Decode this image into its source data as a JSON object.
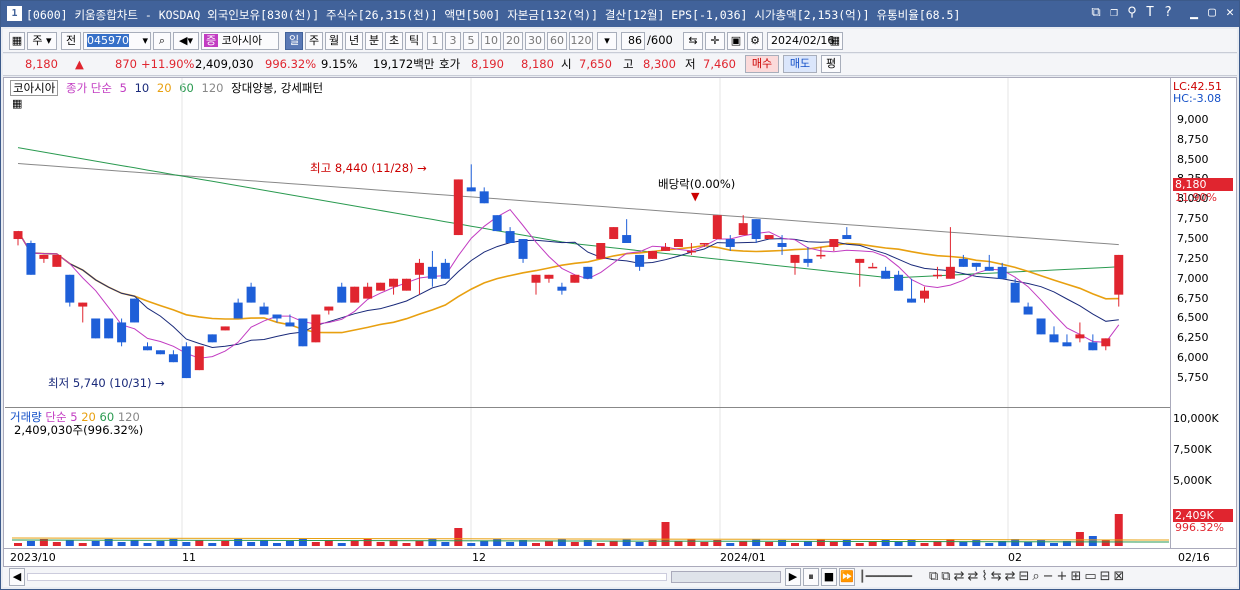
{
  "titlebar": {
    "window_no": "1",
    "title": "[0600] 키움종합차트 - KOSDAQ 외국인보유[830(천)] 주식수[26,315(천)] 액면[500] 자본금[132(억)] 결산[12월] EPS[-1,036] 시가총액[2,153(억)] 유통비율[68.5]"
  },
  "toolbar": {
    "period_week": "주",
    "prev_label": "전",
    "code": "045970",
    "stock_name": "코아시아",
    "tab_day": "일",
    "tab_week": "주",
    "tab_month": "월",
    "tab_year": "년",
    "tab_min": "분",
    "tab_sec": "초",
    "tab_tick": "틱",
    "intervals": [
      "1",
      "3",
      "5",
      "10",
      "20",
      "30",
      "60",
      "120"
    ],
    "count": "86",
    "count_max": "/600",
    "date": "2024/02/16"
  },
  "quote": {
    "price": "8,180",
    "change": "870",
    "change_pct": "+11.90%",
    "volume": "2,409,030",
    "volume_pct": "996.32%",
    "turnover": "9.15%",
    "amount": "19,172백만",
    "hoga_label": "호가",
    "bid": "8,190",
    "ask": "8,180",
    "open_label": "시",
    "open": "7,650",
    "high_label": "고",
    "high": "8,300",
    "low_label": "저",
    "low": "7,460",
    "buy_label": "매수",
    "sell_label": "매도",
    "flat_label": "평"
  },
  "legend": {
    "stock": "코아시아",
    "ma_label": "종가 단순",
    "ma_periods": [
      "5",
      "10",
      "20",
      "60",
      "120"
    ],
    "pattern": "장대양봉, 강세패턴"
  },
  "vol_legend": {
    "label": "거래량",
    "ma_label": "단순",
    "ma_periods": [
      "5",
      "20",
      "60",
      "120"
    ],
    "current": "2,409,030주(996.32%)"
  },
  "annotations": {
    "high": "최고 8,440 (11/28)",
    "low": "최저 5,740 (10/31)",
    "div": "배당락(0.00%)"
  },
  "right_axis": {
    "lc": "LC:42.51",
    "hc": "HC:-3.08",
    "price_ticks": [
      "9,000",
      "8,750",
      "8,500",
      "8,250",
      "8,000",
      "7,750",
      "7,500",
      "7,250",
      "7,000",
      "6,750",
      "6,500",
      "6,250",
      "6,000",
      "5,750"
    ],
    "price_tag": "8,180",
    "price_pct": "11.90%",
    "vol_ticks": [
      "10,000K",
      "7,500K",
      "5,000K"
    ],
    "vol_tag": "2,409K",
    "vol_pct": "996.32%"
  },
  "x_labels": [
    "2023/10",
    "11",
    "12",
    "2024/01",
    "02",
    "02/16"
  ],
  "colors": {
    "up": "#e0252f",
    "down": "#1e5fd8",
    "ma5": "#c23cc2",
    "ma10": "#1a2a7a",
    "ma20": "#e8a010",
    "ma60": "#2a9a50",
    "ma120": "#888888"
  },
  "chart_data": {
    "type": "candlestick",
    "ylim": [
      5600,
      9300
    ],
    "candles": [
      [
        7500,
        7550,
        7420,
        7600
      ],
      [
        7450,
        7480,
        7050,
        7050
      ],
      [
        7250,
        7300,
        7200,
        7300
      ],
      [
        7150,
        7200,
        7150,
        7300
      ],
      [
        7050,
        7050,
        6650,
        6700
      ],
      [
        6650,
        6700,
        6450,
        6700
      ],
      [
        6500,
        6500,
        6250,
        6250
      ],
      [
        6500,
        6500,
        6250,
        6250
      ],
      [
        6450,
        6500,
        6150,
        6200
      ],
      [
        6750,
        6750,
        6450,
        6450
      ],
      [
        6150,
        6200,
        6100,
        6100
      ],
      [
        6100,
        6100,
        6050,
        6050
      ],
      [
        6050,
        6100,
        5950,
        5950
      ],
      [
        6150,
        6200,
        5750,
        5750
      ],
      [
        5850,
        6150,
        5850,
        6150
      ],
      [
        6300,
        6300,
        6200,
        6200
      ],
      [
        6350,
        6400,
        6350,
        6400
      ],
      [
        6700,
        6750,
        6500,
        6500
      ],
      [
        6900,
        6950,
        6700,
        6700
      ],
      [
        6650,
        6700,
        6550,
        6550
      ],
      [
        6550,
        6550,
        6450,
        6500
      ],
      [
        6450,
        6550,
        6400,
        6400
      ],
      [
        6500,
        6500,
        6150,
        6150
      ],
      [
        6200,
        6550,
        6200,
        6550
      ],
      [
        6600,
        6650,
        6550,
        6650
      ],
      [
        6900,
        6950,
        6700,
        6700
      ],
      [
        6700,
        6900,
        6700,
        6900
      ],
      [
        6750,
        6950,
        6750,
        6900
      ],
      [
        6850,
        6900,
        6850,
        6950
      ],
      [
        6900,
        7000,
        6800,
        7000
      ],
      [
        6850,
        7000,
        6850,
        7000
      ],
      [
        7050,
        7250,
        6800,
        7200
      ],
      [
        7150,
        7350,
        6900,
        7000
      ],
      [
        7200,
        7250,
        7000,
        7000
      ],
      [
        7550,
        8250,
        7550,
        8250
      ],
      [
        8150,
        8440,
        8100,
        8100
      ],
      [
        8100,
        8150,
        7950,
        7950
      ],
      [
        7800,
        7800,
        7600,
        7600
      ],
      [
        7600,
        7650,
        7450,
        7450
      ],
      [
        7500,
        7500,
        7200,
        7250
      ],
      [
        6950,
        7000,
        6800,
        7050
      ],
      [
        7000,
        7050,
        6950,
        7050
      ],
      [
        6900,
        6950,
        6800,
        6850
      ],
      [
        6950,
        7050,
        6950,
        7050
      ],
      [
        7150,
        7150,
        7050,
        7000
      ],
      [
        7250,
        7250,
        7450,
        7450
      ],
      [
        7500,
        7500,
        7650,
        7650
      ],
      [
        7550,
        7750,
        7650,
        7450
      ],
      [
        7300,
        7300,
        7100,
        7150
      ],
      [
        7250,
        7300,
        7350,
        7350
      ],
      [
        7350,
        7450,
        7350,
        7400
      ],
      [
        7400,
        7500,
        7400,
        7500
      ],
      [
        7350,
        7450,
        7300,
        7350
      ],
      [
        7450,
        7450,
        7400,
        7450
      ],
      [
        7500,
        7800,
        7500,
        7800
      ],
      [
        7500,
        7550,
        7350,
        7400
      ],
      [
        7550,
        7800,
        7550,
        7700
      ],
      [
        7750,
        7750,
        7450,
        7500
      ],
      [
        7500,
        7550,
        7500,
        7550
      ],
      [
        7450,
        7550,
        7300,
        7400
      ],
      [
        7200,
        7300,
        7050,
        7300
      ],
      [
        7250,
        7400,
        7150,
        7200
      ],
      [
        7300,
        7400,
        7250,
        7300
      ],
      [
        7400,
        7500,
        7350,
        7500
      ],
      [
        7550,
        7650,
        7500,
        7500
      ],
      [
        7200,
        7250,
        6900,
        7250
      ],
      [
        7150,
        7200,
        7150,
        7150
      ],
      [
        7100,
        7150,
        7000,
        7000
      ],
      [
        7050,
        7100,
        6850,
        6850
      ],
      [
        6750,
        7000,
        6700,
        6700
      ],
      [
        6750,
        6900,
        6700,
        6850
      ],
      [
        7050,
        7150,
        7000,
        7050
      ],
      [
        7000,
        7650,
        7000,
        7150
      ],
      [
        7250,
        7300,
        7150,
        7150
      ],
      [
        7200,
        7200,
        7100,
        7150
      ],
      [
        7150,
        7300,
        7100,
        7100
      ],
      [
        7150,
        7200,
        7000,
        7000
      ],
      [
        6950,
        7000,
        6700,
        6700
      ],
      [
        6650,
        6700,
        6550,
        6550
      ],
      [
        6500,
        6500,
        6300,
        6300
      ],
      [
        6300,
        6400,
        6200,
        6200
      ],
      [
        6200,
        6300,
        6150,
        6150
      ],
      [
        6250,
        6450,
        6200,
        6300
      ],
      [
        6200,
        6300,
        6100,
        6100
      ],
      [
        6150,
        6250,
        6100,
        6250
      ],
      [
        6800,
        7300,
        6650,
        7300
      ]
    ]
  }
}
